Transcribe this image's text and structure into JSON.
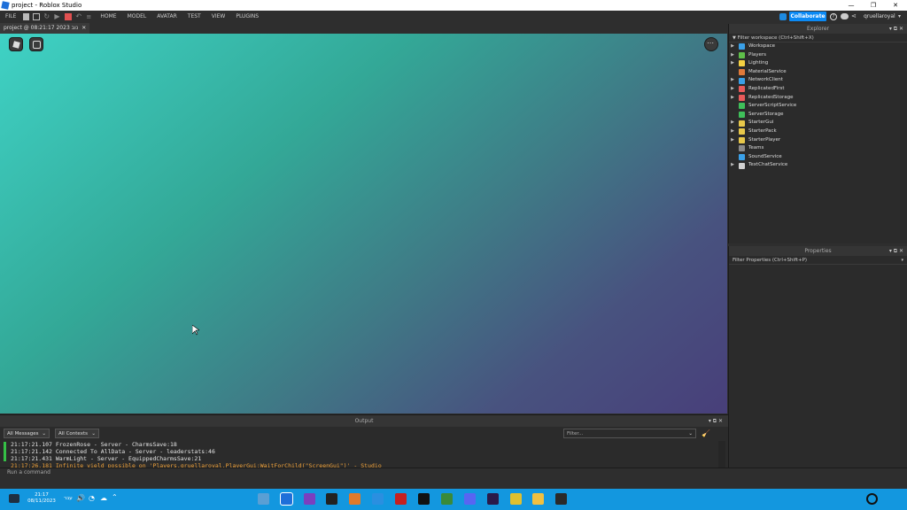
{
  "window": {
    "title": "project - Roblox Studio"
  },
  "menubar": {
    "items": [
      "FILE",
      "HOME",
      "MODEL",
      "AVATAR",
      "TEST",
      "VIEW",
      "PLUGINS"
    ],
    "collaborate_label": "Collaborate",
    "username": "qruellaroyal"
  },
  "tab": {
    "title": "project @ 08:21:17 2023 נוב",
    "close": "✕"
  },
  "explorer": {
    "title": "Explorer",
    "filter_placeholder": "Filter workspace (Ctrl+Shift+X)",
    "items": [
      {
        "label": "Workspace",
        "expandable": true,
        "icon": "workspace-icon",
        "color": "#3aa0e8"
      },
      {
        "label": "Players",
        "expandable": true,
        "icon": "players-icon",
        "color": "#5fbf4a"
      },
      {
        "label": "Lighting",
        "expandable": true,
        "icon": "lighting-icon",
        "color": "#f5d142"
      },
      {
        "label": "MaterialService",
        "expandable": false,
        "icon": "material-service-icon",
        "color": "#e07a3a"
      },
      {
        "label": "NetworkClient",
        "expandable": true,
        "icon": "network-client-icon",
        "color": "#3aa0e8"
      },
      {
        "label": "ReplicatedFirst",
        "expandable": true,
        "icon": "replicated-first-icon",
        "color": "#e85a5a"
      },
      {
        "label": "ReplicatedStorage",
        "expandable": true,
        "icon": "replicated-storage-icon",
        "color": "#e85a5a"
      },
      {
        "label": "ServerScriptService",
        "expandable": false,
        "icon": "server-script-service-icon",
        "color": "#3fbf5a"
      },
      {
        "label": "ServerStorage",
        "expandable": false,
        "icon": "server-storage-icon",
        "color": "#3fbf5a"
      },
      {
        "label": "StarterGui",
        "expandable": true,
        "icon": "starter-gui-icon",
        "color": "#e8c84a"
      },
      {
        "label": "StarterPack",
        "expandable": true,
        "icon": "starter-pack-icon",
        "color": "#e8c84a"
      },
      {
        "label": "StarterPlayer",
        "expandable": true,
        "icon": "starter-player-icon",
        "color": "#e8c84a"
      },
      {
        "label": "Teams",
        "expandable": false,
        "icon": "teams-icon",
        "color": "#8a8a8a"
      },
      {
        "label": "SoundService",
        "expandable": false,
        "icon": "sound-service-icon",
        "color": "#3aa0e8"
      },
      {
        "label": "TextChatService",
        "expandable": true,
        "icon": "text-chat-service-icon",
        "color": "#d0d0d0"
      }
    ]
  },
  "properties": {
    "title": "Properties",
    "filter_placeholder": "Filter Properties (Ctrl+Shift+P)"
  },
  "output": {
    "title": "Output",
    "messages_filter": "All Messages",
    "contexts_filter": "All Contexts",
    "search_placeholder": "Filter...",
    "lines": [
      {
        "text": "21:17:21.107  FrozenRose  -  Server - CharmsSave:18",
        "level": "info"
      },
      {
        "text": "21:17:21.142  Connected To AllData  -  Server - leaderstats:46",
        "level": "info"
      },
      {
        "text": "21:17:21.431  WarmLight  -  Server - EquippedCharmsSave:21",
        "level": "info"
      },
      {
        "text": "21:17:26.181  Infinite yield possible on 'Players.qruellaroyal.PlayerGui:WaitForChild(\"ScreenGui\")'  -  Studio",
        "level": "warn"
      }
    ]
  },
  "command_bar": {
    "placeholder": "Run a command"
  },
  "taskbar": {
    "time": "21:17",
    "date": "08/11/2023",
    "language": "עבר",
    "pinned_icons": [
      "tp-icon",
      "roblox-studio-icon",
      "visual-studio-icon",
      "unreal-icon",
      "blender-icon",
      "files-icon",
      "roblox-red-icon",
      "github-icon",
      "robot-icon",
      "discord-icon",
      "after-effects-icon",
      "chrome-icon",
      "file-explorer-icon",
      "minecraft-icon",
      "search-icon"
    ]
  }
}
